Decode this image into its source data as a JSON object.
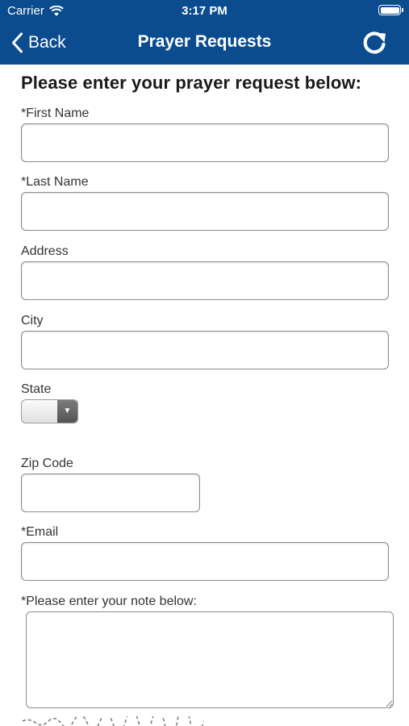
{
  "status_bar": {
    "carrier": "Carrier",
    "time": "3:17 PM"
  },
  "nav": {
    "back_label": "Back",
    "title": "Prayer Requests",
    "refresh_icon": "refresh-icon"
  },
  "form": {
    "heading": "Please enter your prayer request below:",
    "first_name_label": "*First Name",
    "first_name_value": "",
    "last_name_label": "*Last Name",
    "last_name_value": "",
    "address_label": "Address",
    "address_value": "",
    "city_label": "City",
    "city_value": "",
    "state_label": "State",
    "state_value": "",
    "zip_label": "Zip Code",
    "zip_value": "",
    "email_label": "*Email",
    "email_value": "",
    "note_label": "*Please enter your note below:",
    "note_value": ""
  },
  "colors": {
    "nav_background": "#0b4c8f",
    "nav_text": "#ffffff"
  }
}
